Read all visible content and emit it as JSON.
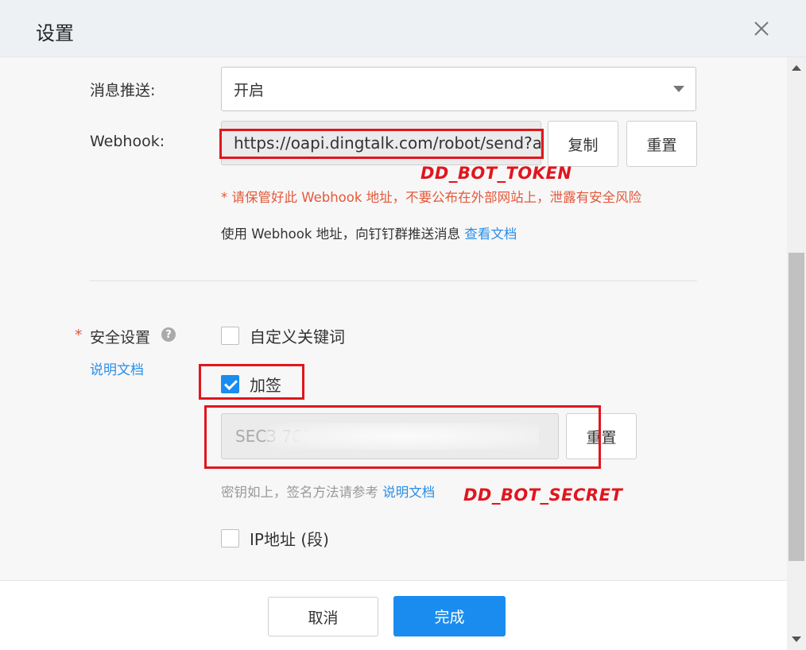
{
  "dialog": {
    "title": "设置",
    "close_icon": "close-icon"
  },
  "push": {
    "label": "消息推送:",
    "selected": "开启"
  },
  "webhook": {
    "label": "Webhook:",
    "value": "https://oapi.dingtalk.com/robot/send?access_token=",
    "copy_label": "复制",
    "reset_label": "重置",
    "annotation": "DD_BOT_TOKEN",
    "warning": "* 请保管好此 Webhook 地址，不要公布在外部网站上，泄露有安全风险",
    "hint_prefix": "使用 Webhook 地址，向钉钉群推送消息",
    "hint_link": "查看文档"
  },
  "security": {
    "required_mark": "*",
    "label": "安全设置",
    "help_icon": "?",
    "doc_link": "说明文档",
    "keyword_label": "自定义关键词",
    "sign_label": "加签",
    "secret_value": "SEC3   76f 2 0                              2a",
    "secret_reset_label": "重置",
    "secret_hint_prefix": "密钥如上，签名方法请参考",
    "secret_hint_link": "说明文档",
    "annotation": "DD_BOT_SECRET",
    "ip_label": "IP地址 (段)"
  },
  "footer": {
    "cancel_label": "取消",
    "done_label": "完成"
  },
  "colors": {
    "primary": "#1a8cf0",
    "link": "#2b8ee8",
    "warning": "#e4583a",
    "annotation_red": "#e0161e"
  }
}
